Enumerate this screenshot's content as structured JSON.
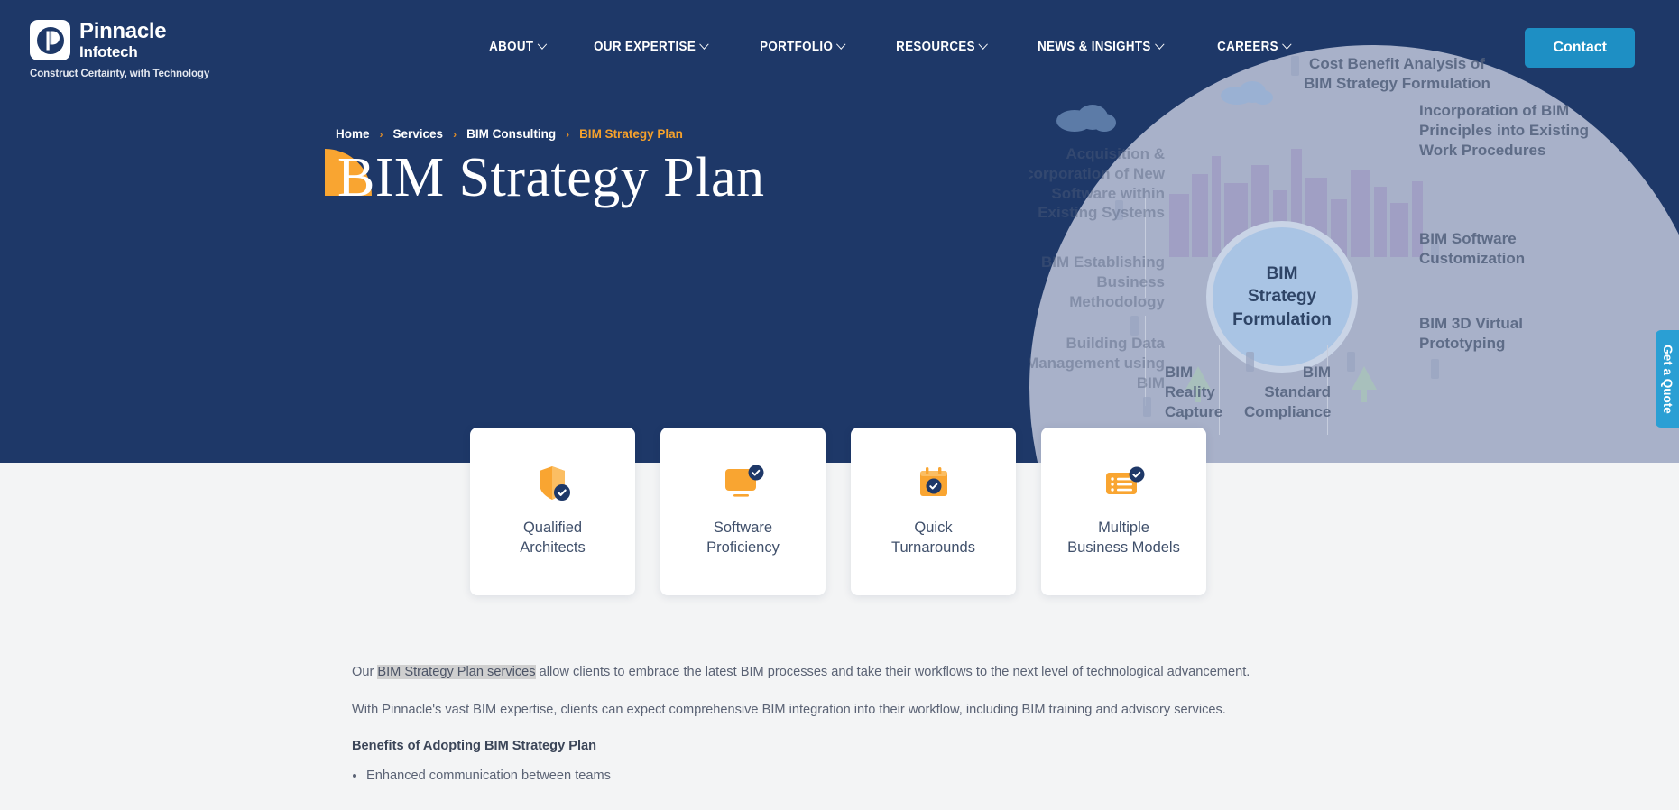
{
  "brand": {
    "name_line1": "Pinnacle",
    "name_line2": "Infotech",
    "tagline": "Construct Certainty, with Technology",
    "logo_icon": "pinnacle-p-logo-icon"
  },
  "colors": {
    "navy": "#1e3868",
    "orange": "#f9a531",
    "accent_blue": "#1e8fc4",
    "quote_blue": "#2a9fd4",
    "page_bg": "#f3f4f5"
  },
  "nav": {
    "items": [
      {
        "label": "ABOUT",
        "has_dropdown": true
      },
      {
        "label": "OUR EXPERTISE",
        "has_dropdown": true
      },
      {
        "label": "PORTFOLIO",
        "has_dropdown": true
      },
      {
        "label": "RESOURCES",
        "has_dropdown": true
      },
      {
        "label": "NEWS & INSIGHTS",
        "has_dropdown": true
      },
      {
        "label": "CAREERS",
        "has_dropdown": true
      }
    ],
    "contact_label": "Contact"
  },
  "breadcrumb": {
    "items": [
      "Home",
      "Services",
      "BIM Consulting"
    ],
    "current": "BIM Strategy Plan",
    "separator": "›"
  },
  "hero": {
    "title": "BIM Strategy Plan",
    "graphic": {
      "center_label": "BIM\nStrategy\nFormulation",
      "labels": [
        "Cost Benefit Analysis of BIM Strategy Formulation",
        "Incorporation of BIM Principles into Existing Work Procedures",
        "BIM Software Customization",
        "BIM 3D Virtual Prototyping",
        "Acquisition & Incorporation of New Software within Existing Systems",
        "BIM Establishing Business Methodology",
        "Building Data Management using BIM",
        "BIM Reality Capture",
        "BIM Standard Compliance"
      ]
    }
  },
  "quote_tab": {
    "label": "Get a Quote"
  },
  "cards": [
    {
      "label": "Qualified\nArchitects",
      "icon": "shield-check-icon"
    },
    {
      "label": "Software\nProficiency",
      "icon": "monitor-check-icon"
    },
    {
      "label": "Quick\nTurnarounds",
      "icon": "calendar-check-icon"
    },
    {
      "label": "Multiple\nBusiness Models",
      "icon": "list-check-icon"
    }
  ],
  "content": {
    "paragraph_1_pre": "Our ",
    "paragraph_1_highlight": "BIM Strategy Plan services",
    "paragraph_1_post": " allow clients to embrace the latest BIM processes and take their workflows to the next level of technological advancement.",
    "paragraph_2": "With Pinnacle's vast BIM expertise, clients can expect comprehensive BIM integration into their workflow, including BIM training and advisory services.",
    "benefits_heading": "Benefits of Adopting BIM Strategy Plan",
    "benefits": [
      "Enhanced communication between teams"
    ]
  }
}
